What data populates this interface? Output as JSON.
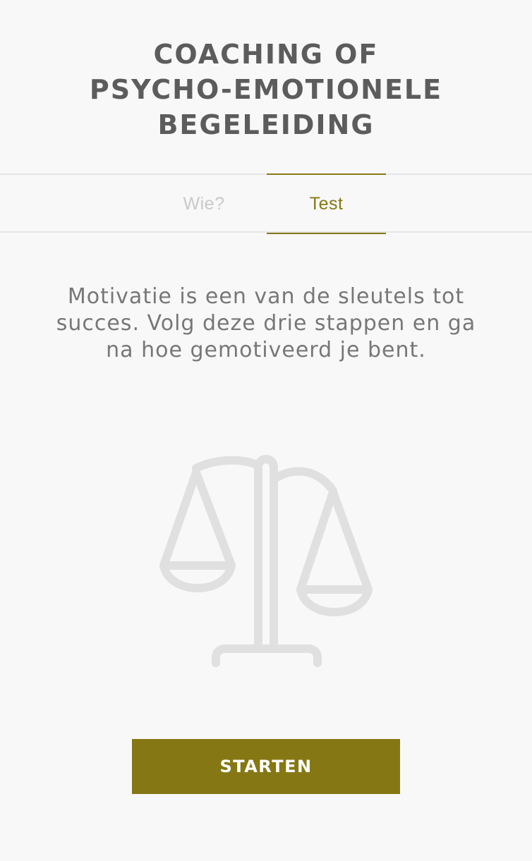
{
  "header": {
    "title_lines": [
      "COACHING OF",
      "PSYCHO-EMOTIONELE",
      "BEGELEIDING"
    ]
  },
  "tabs": [
    {
      "label": "Wie?",
      "active": false
    },
    {
      "label": "Test",
      "active": true
    }
  ],
  "intro": {
    "text": "Motivatie is een van de sleutels tot succes. Volg deze drie stappen en ga na hoe gemotiveerd je bent."
  },
  "illustration": {
    "icon": "balance-scale-icon",
    "color": "#e0e0e0"
  },
  "actions": {
    "start_label": "STARTEN"
  },
  "colors": {
    "accent": "#857814",
    "title": "#5c5c5c",
    "body_text": "#777777",
    "inactive_tab": "#c9c9c9",
    "background": "#f8f8f8"
  }
}
